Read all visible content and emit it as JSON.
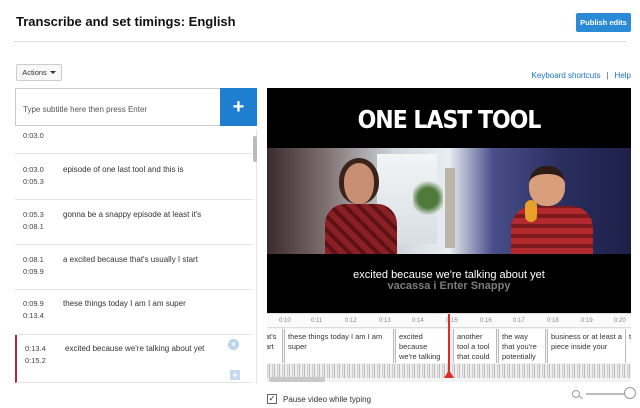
{
  "header": {
    "title": "Transcribe and set timings: English",
    "publish_label": "Publish edits"
  },
  "toolbar": {
    "actions_label": "Actions",
    "keyboard_shortcuts": "Keyboard shortcuts",
    "separator": "|",
    "help": "Help"
  },
  "input": {
    "placeholder": "Type subtitle here then press Enter",
    "add_symbol": "+"
  },
  "subtitles": [
    {
      "start": "",
      "end": "0:03.0",
      "text": ""
    },
    {
      "start": "0:03.0",
      "end": "0:05.3",
      "text": "episode of one last tool and this is"
    },
    {
      "start": "0:05.3",
      "end": "0:08.1",
      "text": "gonna be a snappy episode at least it's"
    },
    {
      "start": "0:08.1",
      "end": "0:09.9",
      "text": "a excited because that's usually I start"
    },
    {
      "start": "0:09.9",
      "end": "0:13.4",
      "text": "these things today I am I am super"
    },
    {
      "start": "0:13.4",
      "end": "0:15.2",
      "text": "excited because we're talking about yet"
    }
  ],
  "row_controls": {
    "remove_symbol": "×",
    "insert_symbol": "+"
  },
  "video": {
    "title_overlay": "ONE LAST TOOL",
    "caption": "excited because we're talking about yet",
    "ghost_caption": "vacassa i Enter Snappy"
  },
  "timeline": {
    "ticks": [
      "0:10",
      "0:11",
      "0:12",
      "0:13",
      "0:14",
      "0:15",
      "0:16",
      "0:17",
      "0:18",
      "0:19",
      "0:20"
    ],
    "segments": [
      "at's art",
      "these things today I am I am super",
      "excited because we're talking about",
      "another tool a tool that could",
      "the way that you're potentially",
      "business or at least a piece inside your",
      "to"
    ]
  },
  "footer": {
    "pause_label": "Pause video while typing",
    "pause_checked": true,
    "checkmark": "✓"
  },
  "colors": {
    "accent": "#2b8ad6",
    "active_row": "#b02a37",
    "playhead": "#e02b2b"
  }
}
